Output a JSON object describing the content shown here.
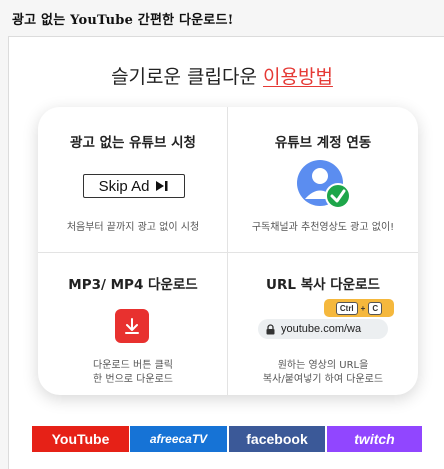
{
  "header": {
    "title": "광고 없는 YouTube  간편한 다운로드!"
  },
  "headline": {
    "prefix": "슬기로운 클립다운 ",
    "accent": "이용방법"
  },
  "features": {
    "ad_free": {
      "title": "광고 없는 유튜브 시청",
      "button_label": "Skip Ad",
      "desc": "처음부터 끝까지 광고 없이 시청"
    },
    "account": {
      "title": "유튜브 계정 연동",
      "desc": "구독채널과 추천영상도 광고 없이!"
    },
    "mp3": {
      "title": "MP3/ MP4 다운로드",
      "desc_line1": "다운로드 버튼 클릭",
      "desc_line2": "한 번으로 다운로드"
    },
    "url": {
      "title": "URL 복사 다운로드",
      "url_text": "youtube.com/wa",
      "key_ctrl": "Ctrl",
      "key_plus": "+",
      "key_c": "C",
      "desc_line1": "원하는 영상의 URL을",
      "desc_line2": "복사/붙여넣기 하여 다운로드"
    }
  },
  "platforms": [
    "YouTube",
    "afreecaTV",
    "facebook",
    "twitch"
  ],
  "colors": {
    "accent": "#e53935",
    "youtube": "#e62117",
    "afreeca": "#1673d6",
    "facebook": "#3b5998",
    "twitch": "#9146ff",
    "check": "#1ea64a",
    "avatar": "#5b8df0"
  }
}
